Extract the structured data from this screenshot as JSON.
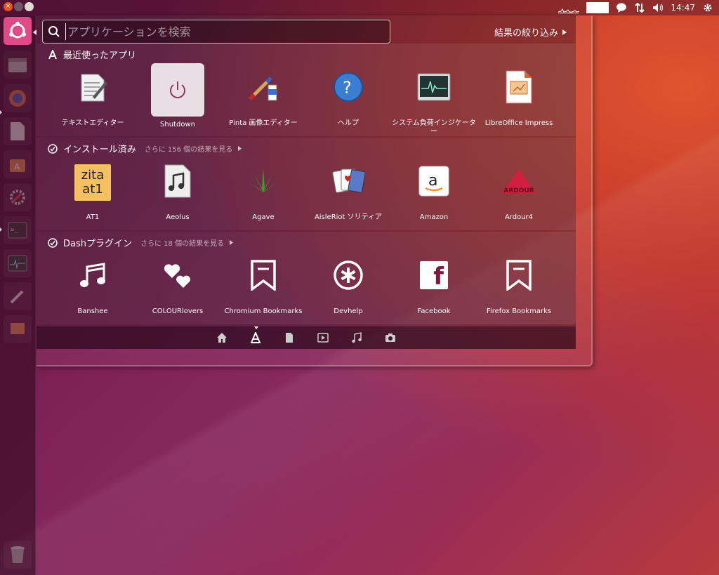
{
  "panel": {
    "clock": "14:47"
  },
  "search": {
    "placeholder": "アプリケーションを検索",
    "filter_label": "結果の絞り込み"
  },
  "categories": [
    {
      "title": "最近使ったアプリ",
      "more": "",
      "icon": "apps-icon",
      "items": [
        {
          "label": "テキストエディター",
          "icon": "text-editor-icon"
        },
        {
          "label": "Shutdown",
          "icon": "power-icon"
        },
        {
          "label": "Pinta 画像エディター",
          "icon": "pinta-icon"
        },
        {
          "label": "ヘルプ",
          "icon": "help-icon"
        },
        {
          "label": "システム負荷インジケーター",
          "icon": "system-monitor-icon"
        },
        {
          "label": "LibreOffice Impress",
          "icon": "impress-icon"
        }
      ]
    },
    {
      "title": "インストール済み",
      "more": "さらに 156 個の結果を見る",
      "icon": "check-icon",
      "items": [
        {
          "label": "AT1",
          "icon": "zita-at1-icon",
          "text": "zita at1"
        },
        {
          "label": "Aeolus",
          "icon": "aeolus-icon"
        },
        {
          "label": "Agave",
          "icon": "agave-icon"
        },
        {
          "label": "AisleRiot ソリティア",
          "icon": "cards-icon"
        },
        {
          "label": "Amazon",
          "icon": "amazon-icon"
        },
        {
          "label": "Ardour4",
          "icon": "ardour-icon",
          "text": "ARDOUR"
        }
      ]
    },
    {
      "title": "Dashプラグイン",
      "more": "さらに 18 個の結果を見る",
      "icon": "check-icon",
      "items": [
        {
          "label": "Banshee",
          "icon": "music-note-icon"
        },
        {
          "label": "COLOURlovers",
          "icon": "hearts-icon"
        },
        {
          "label": "Chromium Bookmarks",
          "icon": "bookmark-icon"
        },
        {
          "label": "Devhelp",
          "icon": "devhelp-icon"
        },
        {
          "label": "Facebook",
          "icon": "facebook-icon",
          "text": "f"
        },
        {
          "label": "Firefox Bookmarks",
          "icon": "bookmark-icon"
        }
      ]
    }
  ],
  "lenses": [
    "home-lens-icon",
    "apps-lens-icon",
    "files-lens-icon",
    "video-lens-icon",
    "music-lens-icon",
    "photo-lens-icon"
  ],
  "colors": {
    "accent": "#e95420",
    "launcher_active": "#e04a86"
  }
}
